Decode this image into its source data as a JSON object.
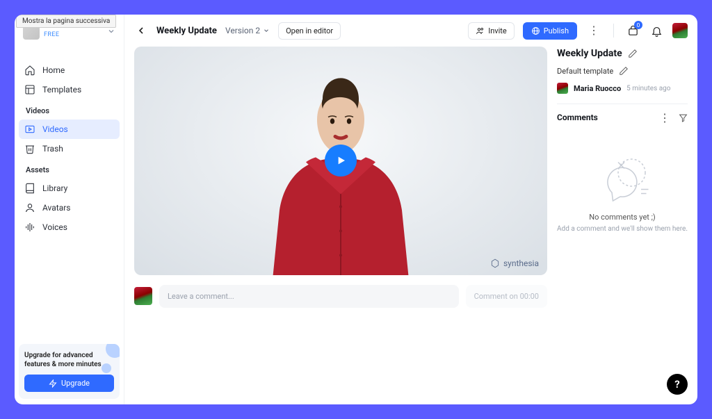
{
  "tooltip": "Mostra la pagina successiva",
  "sidebar": {
    "plan_badge": "FREE",
    "items": [
      {
        "label": "Home"
      },
      {
        "label": "Templates"
      }
    ],
    "videos_section": {
      "heading": "Videos",
      "items": [
        {
          "label": "Videos"
        },
        {
          "label": "Trash"
        }
      ]
    },
    "assets_section": {
      "heading": "Assets",
      "items": [
        {
          "label": "Library"
        },
        {
          "label": "Avatars"
        },
        {
          "label": "Voices"
        }
      ]
    },
    "upgrade": {
      "text": "Upgrade for advanced features & more minutes",
      "button": "Upgrade"
    }
  },
  "topbar": {
    "title": "Weekly Update",
    "version": "Version 2",
    "open_editor": "Open in editor",
    "invite": "Invite",
    "publish": "Publish",
    "notifications_count": "0"
  },
  "video": {
    "watermark": "synthesia"
  },
  "comment_bar": {
    "placeholder": "Leave a comment...",
    "timestamp_label": "Comment on 00:00"
  },
  "right": {
    "title": "Weekly Update",
    "template": "Default template",
    "author": "Maria Ruocco",
    "time": "5 minutes ago",
    "comments_heading": "Comments",
    "empty_title": "No comments yet ;)",
    "empty_sub": "Add a comment and we'll show them here."
  }
}
